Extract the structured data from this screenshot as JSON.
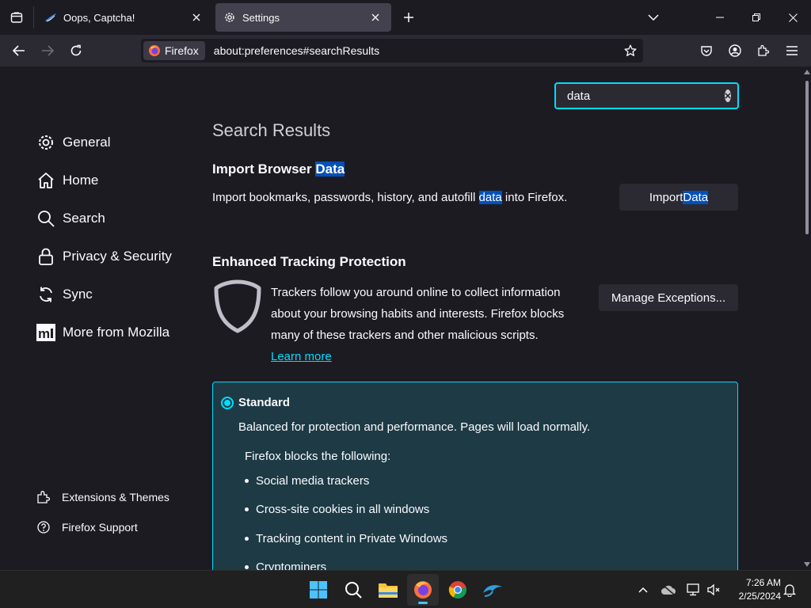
{
  "tabs": [
    {
      "title": "Oops, Captcha!",
      "icon": "bird-favicon"
    },
    {
      "title": "Settings",
      "icon": "gear-icon",
      "active": true
    }
  ],
  "urlbar": {
    "identity_label": "Firefox",
    "url": "about:preferences#searchResults"
  },
  "search": {
    "value": "data"
  },
  "sidebar": {
    "categories": [
      {
        "label": "General",
        "icon": "gear-icon"
      },
      {
        "label": "Home",
        "icon": "home-icon"
      },
      {
        "label": "Search",
        "icon": "magnifier-icon"
      },
      {
        "label": "Privacy & Security",
        "icon": "lock-icon"
      },
      {
        "label": "Sync",
        "icon": "sync-icon"
      },
      {
        "label": "More from Mozilla",
        "icon": "mozilla-icon"
      }
    ],
    "footer_links": [
      {
        "label": "Extensions & Themes",
        "icon": "puzzle-icon"
      },
      {
        "label": "Firefox Support",
        "icon": "help-icon"
      }
    ]
  },
  "main": {
    "results_heading": "Search Results",
    "import": {
      "title_prefix": "Import Browser ",
      "title_highlight": "Data",
      "desc_prefix": "Import bookmarks, passwords, history, and autofill ",
      "desc_highlight": "data",
      "desc_suffix": " into Firefox.",
      "button_prefix": "Import ",
      "button_highlight": "Data"
    },
    "etp": {
      "title": "Enhanced Tracking Protection",
      "desc": "Trackers follow you around online to collect information about your browsing habits and interests. Firefox blocks many of these trackers and other malicious scripts.",
      "learn_more": "Learn more",
      "manage_button": "Manage Exceptions..."
    },
    "standard": {
      "label": "Standard",
      "desc": "Balanced for protection and performance. Pages will load normally.",
      "blocks_label": "Firefox blocks the following:",
      "items": [
        "Social media trackers",
        "Cross-site cookies in all windows",
        "Tracking content in Private Windows",
        "Cryptominers"
      ]
    }
  },
  "taskbar": {
    "time": "7:26 AM",
    "date": "2/25/2024"
  },
  "colors": {
    "accent": "#00ddff",
    "highlight": "#0250bb",
    "background": "#1c1b22",
    "toolbar": "#2b2a33"
  }
}
